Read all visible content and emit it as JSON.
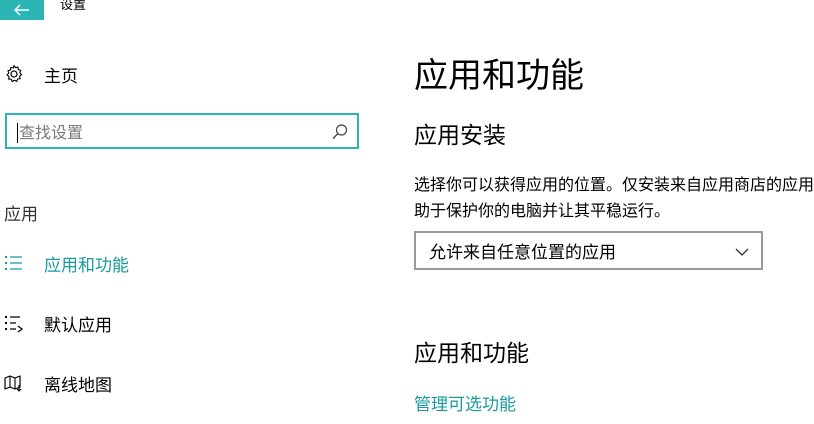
{
  "window": {
    "title": "设置"
  },
  "sidebar": {
    "home_label": "主页",
    "search": {
      "placeholder": "查找设置",
      "value": ""
    },
    "section_label": "应用",
    "items": [
      {
        "label": "应用和功能",
        "icon": "apps-features-icon",
        "active": true
      },
      {
        "label": "默认应用",
        "icon": "default-apps-icon",
        "active": false
      },
      {
        "label": "离线地图",
        "icon": "offline-maps-icon",
        "active": false
      }
    ]
  },
  "main": {
    "title": "应用和功能",
    "install": {
      "heading": "应用安装",
      "description": "选择你可以获得应用的位置。仅安装来自应用商店的应用有助于保护你的电脑并让其平稳运行。",
      "dropdown_value": "允许来自任意位置的应用"
    },
    "apps": {
      "heading": "应用和功能",
      "manage_link": "管理可选功能"
    }
  },
  "colors": {
    "accent": "#2cb5b5",
    "accent_text": "#1a9b9b",
    "dropdown_border": "#999999"
  }
}
